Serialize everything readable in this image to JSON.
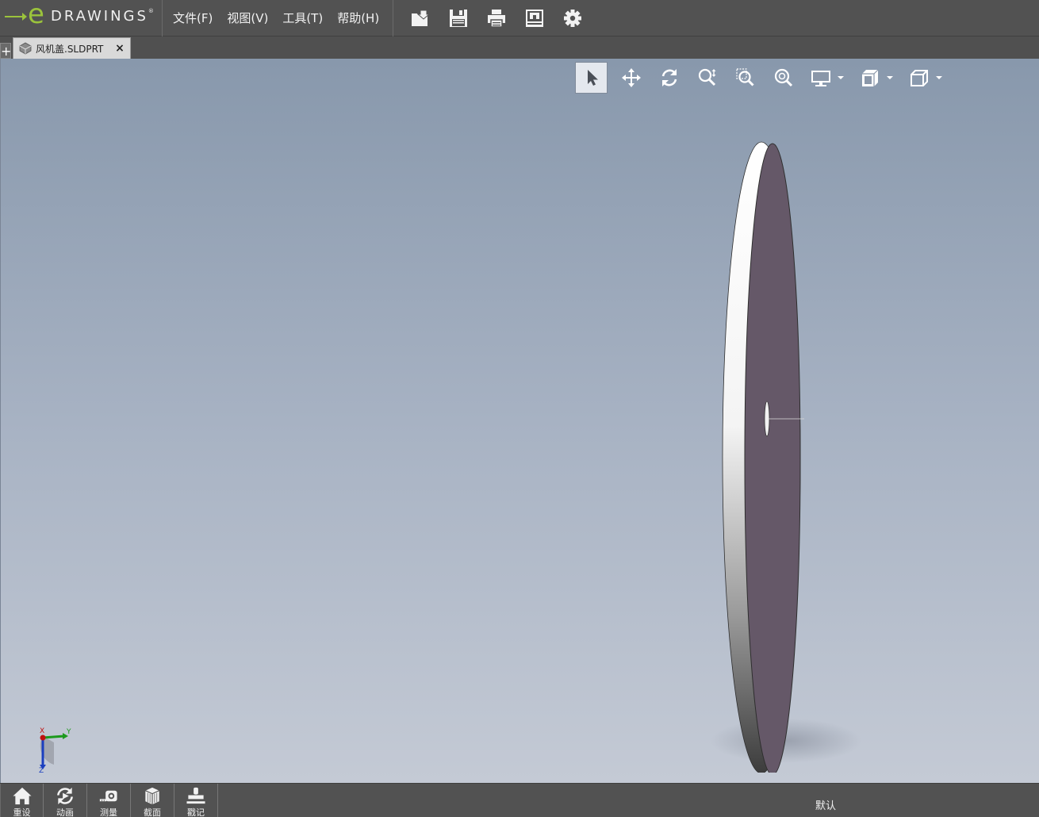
{
  "app": {
    "logo_word": "DRAWINGS",
    "logo_letter": "e",
    "logo_reg": "®",
    "accent_color": "#9bc33c"
  },
  "menu": [
    {
      "label": "文件(F)"
    },
    {
      "label": "视图(V)"
    },
    {
      "label": "工具(T)"
    },
    {
      "label": "帮助(H)"
    }
  ],
  "file_toolbar": [
    "open-icon",
    "save-icon",
    "print-icon",
    "publish-icon",
    "gear-icon"
  ],
  "tabs": {
    "add_label": "+",
    "document": {
      "title": "风机盖.SLDPRT",
      "close": "×"
    }
  },
  "view_toolbar": [
    "select-icon",
    "pan-icon",
    "rotate-icon",
    "zoom-icon",
    "zoom-to-area-icon",
    "zoom-to-fit-icon",
    "display-style-icon",
    "view-orientation-icon",
    "standard-views-icon"
  ],
  "triad": {
    "x": "X",
    "y": "Y",
    "z": "Z"
  },
  "bottom_bar": {
    "buttons": [
      {
        "icon": "home-icon",
        "label": "重设"
      },
      {
        "icon": "animate-icon",
        "label": "动画"
      },
      {
        "icon": "measure-icon",
        "label": "测量"
      },
      {
        "icon": "section-icon",
        "label": "截面"
      },
      {
        "icon": "markup-icon",
        "label": "戳记"
      }
    ],
    "configuration": "默认"
  },
  "viewport": {
    "background_top": "#8898ac",
    "background_bottom": "#c4cad5",
    "part_face_color": "#655868"
  }
}
